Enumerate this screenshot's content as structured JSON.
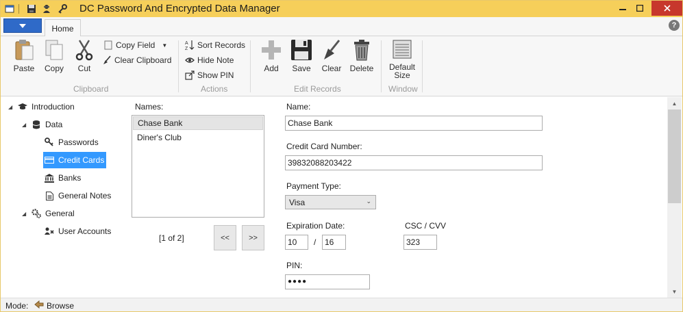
{
  "window": {
    "title": "DC Password And Encrypted Data Manager"
  },
  "quick_access": [
    "app-icon",
    "save-icon",
    "agent-icon",
    "key-icon"
  ],
  "window_controls": [
    "minimize-icon",
    "maximize-icon",
    "close-icon"
  ],
  "ribbon": {
    "tabs": [
      {
        "label": "Home",
        "active": true
      }
    ],
    "help_label": "?",
    "groups": {
      "clipboard": {
        "label": "Clipboard",
        "paste": "Paste",
        "copy": "Copy",
        "cut": "Cut",
        "copy_field": "Copy Field",
        "clear_clipboard": "Clear Clipboard"
      },
      "actions": {
        "label": "Actions",
        "sort_records": "Sort Records",
        "hide_note": "Hide Note",
        "show_pin": "Show PIN"
      },
      "edit_records": {
        "label": "Edit Records",
        "add": "Add",
        "save": "Save",
        "clear": "Clear",
        "delete": "Delete"
      },
      "window": {
        "label": "Window",
        "default_size_line1": "Default",
        "default_size_line2": "Size"
      }
    }
  },
  "tree": {
    "items": [
      {
        "label": "Introduction",
        "icon": "graduation-cap-icon",
        "expanded": true
      },
      {
        "label": "Data",
        "icon": "database-icon",
        "expanded": true
      },
      {
        "label": "Passwords",
        "icon": "key-icon"
      },
      {
        "label": "Credit Cards",
        "icon": "credit-card-icon",
        "selected": true
      },
      {
        "label": "Banks",
        "icon": "bank-icon"
      },
      {
        "label": "General Notes",
        "icon": "note-icon"
      },
      {
        "label": "General",
        "icon": "gears-icon",
        "expanded": true
      },
      {
        "label": "User Accounts",
        "icon": "users-icon"
      }
    ]
  },
  "names": {
    "label": "Names:",
    "items": [
      "Chase Bank",
      "Diner's Club"
    ],
    "selected": "Chase Bank",
    "pager": "[1 of 2]",
    "prev_label": "<<",
    "next_label": ">>"
  },
  "form": {
    "name_label": "Name:",
    "name_value": "Chase Bank",
    "card_number_label": "Credit Card Number:",
    "card_number_value": "39832088203422",
    "payment_type_label": "Payment Type:",
    "payment_type_value": "Visa",
    "expiration_label": "Expiration Date:",
    "exp_month": "10",
    "exp_sep": "/",
    "exp_year": "16",
    "csc_label": "CSC / CVV",
    "csc_value": "323",
    "pin_label": "PIN:",
    "pin_value": "●●●●"
  },
  "status": {
    "mode_label": "Mode:",
    "mode_value": "Browse"
  },
  "colors": {
    "title_bar": "#f6cf5a",
    "close_button": "#c7372c",
    "app_menu": "#2f6ac8",
    "selection": "#3399ff"
  }
}
